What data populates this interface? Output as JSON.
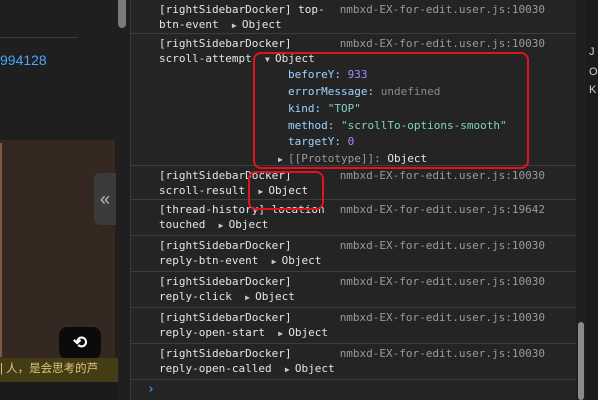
{
  "left_panel": {
    "number_fragment": "994128",
    "reload_icon": "reload-icon",
    "bottom_text": "| 人，是会思考的芦",
    "collapse_icon": "double-chevron-left-icon",
    "collapse_glyph": "«"
  },
  "console": {
    "entries": [
      {
        "line1": "[rightSidebarDocker] top-",
        "line2": "btn-event",
        "object": "Object",
        "source": "nmbxd-EX-for-edit.user.js:10030"
      },
      {
        "line1": "[rightSidebarDocker]",
        "line2": "scroll-attempt",
        "object": "Object",
        "source": "nmbxd-EX-for-edit.user.js:10030",
        "expanded": true,
        "properties": [
          {
            "key": "beforeY",
            "value": "933",
            "type": "number"
          },
          {
            "key": "errorMessage",
            "value": "undefined",
            "type": "undefined"
          },
          {
            "key": "kind",
            "value": "\"TOP\"",
            "type": "string"
          },
          {
            "key": "method",
            "value": "\"scrollTo-options-smooth\"",
            "type": "string"
          },
          {
            "key": "targetY",
            "value": "0",
            "type": "number"
          }
        ],
        "prototype_label": "[[Prototype]]",
        "prototype_value": "Object"
      },
      {
        "line1": "[rightSidebarDocker]",
        "line2": "scroll-result",
        "object": "Object",
        "source": "nmbxd-EX-for-edit.user.js:10030"
      },
      {
        "line1": "[thread-history] location",
        "line2": "touched",
        "object": "Object",
        "source": "nmbxd-EX-for-edit.user.js:19642"
      },
      {
        "line1": "[rightSidebarDocker]",
        "line2": "reply-btn-event",
        "object": "Object",
        "source": "nmbxd-EX-for-edit.user.js:10030"
      },
      {
        "line1": "[rightSidebarDocker]",
        "line2": "reply-click",
        "object": "Object",
        "source": "nmbxd-EX-for-edit.user.js:10030"
      },
      {
        "line1": "[rightSidebarDocker]",
        "line2": "reply-open-start",
        "object": "Object",
        "source": "nmbxd-EX-for-edit.user.js:10030"
      },
      {
        "line1": "[rightSidebarDocker]",
        "line2": "reply-open-called",
        "object": "Object",
        "source": "nmbxd-EX-for-edit.user.js:10030"
      }
    ],
    "prompt": "›"
  },
  "right_strip": {
    "letters": [
      "J",
      "O",
      "K"
    ]
  },
  "colors": {
    "annotation_red": "#e0141e",
    "link_blue": "#4da3ff",
    "prop_key": "#9fd4ff",
    "number": "#a78bfa",
    "string": "#7fd3c4"
  }
}
